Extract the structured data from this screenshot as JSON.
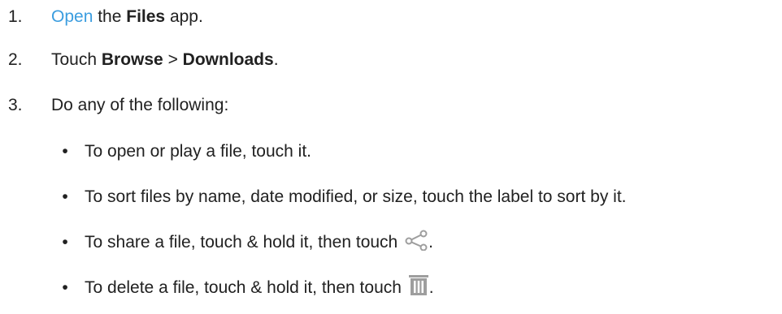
{
  "steps": [
    {
      "number": "1.",
      "link_text": "Open",
      "text_a": " the ",
      "bold_a": "Files",
      "text_b": " app."
    },
    {
      "number": "2.",
      "text_a": "Touch ",
      "bold_a": "Browse",
      "text_b": " > ",
      "bold_b": "Downloads",
      "text_c": "."
    },
    {
      "number": "3.",
      "text_a": "Do any of the following:"
    }
  ],
  "substeps": [
    {
      "bullet": "•",
      "text": "To open or play a file, touch it."
    },
    {
      "bullet": "•",
      "text": "To sort files by name, date modified, or size, touch the label to sort by it."
    },
    {
      "bullet": "•",
      "text": "To share a file, touch & hold it, then touch ",
      "icon": "share-icon",
      "after": "."
    },
    {
      "bullet": "•",
      "text": "To delete a file, touch & hold it, then touch ",
      "icon": "trash-icon",
      "after": "."
    }
  ],
  "colors": {
    "link": "#3b9ddf",
    "text": "#212121",
    "icon": "#9e9e9e"
  }
}
